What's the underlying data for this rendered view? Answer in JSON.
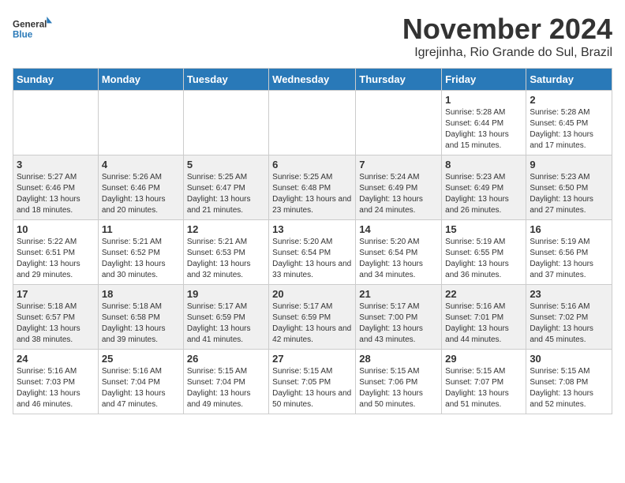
{
  "logo": {
    "line1": "General",
    "line2": "Blue"
  },
  "title": "November 2024",
  "subtitle": "Igrejinha, Rio Grande do Sul, Brazil",
  "days_of_week": [
    "Sunday",
    "Monday",
    "Tuesday",
    "Wednesday",
    "Thursday",
    "Friday",
    "Saturday"
  ],
  "weeks": [
    [
      {
        "day": "",
        "info": ""
      },
      {
        "day": "",
        "info": ""
      },
      {
        "day": "",
        "info": ""
      },
      {
        "day": "",
        "info": ""
      },
      {
        "day": "",
        "info": ""
      },
      {
        "day": "1",
        "info": "Sunrise: 5:28 AM\nSunset: 6:44 PM\nDaylight: 13 hours and 15 minutes."
      },
      {
        "day": "2",
        "info": "Sunrise: 5:28 AM\nSunset: 6:45 PM\nDaylight: 13 hours and 17 minutes."
      }
    ],
    [
      {
        "day": "3",
        "info": "Sunrise: 5:27 AM\nSunset: 6:46 PM\nDaylight: 13 hours and 18 minutes."
      },
      {
        "day": "4",
        "info": "Sunrise: 5:26 AM\nSunset: 6:46 PM\nDaylight: 13 hours and 20 minutes."
      },
      {
        "day": "5",
        "info": "Sunrise: 5:25 AM\nSunset: 6:47 PM\nDaylight: 13 hours and 21 minutes."
      },
      {
        "day": "6",
        "info": "Sunrise: 5:25 AM\nSunset: 6:48 PM\nDaylight: 13 hours and 23 minutes."
      },
      {
        "day": "7",
        "info": "Sunrise: 5:24 AM\nSunset: 6:49 PM\nDaylight: 13 hours and 24 minutes."
      },
      {
        "day": "8",
        "info": "Sunrise: 5:23 AM\nSunset: 6:49 PM\nDaylight: 13 hours and 26 minutes."
      },
      {
        "day": "9",
        "info": "Sunrise: 5:23 AM\nSunset: 6:50 PM\nDaylight: 13 hours and 27 minutes."
      }
    ],
    [
      {
        "day": "10",
        "info": "Sunrise: 5:22 AM\nSunset: 6:51 PM\nDaylight: 13 hours and 29 minutes."
      },
      {
        "day": "11",
        "info": "Sunrise: 5:21 AM\nSunset: 6:52 PM\nDaylight: 13 hours and 30 minutes."
      },
      {
        "day": "12",
        "info": "Sunrise: 5:21 AM\nSunset: 6:53 PM\nDaylight: 13 hours and 32 minutes."
      },
      {
        "day": "13",
        "info": "Sunrise: 5:20 AM\nSunset: 6:54 PM\nDaylight: 13 hours and 33 minutes."
      },
      {
        "day": "14",
        "info": "Sunrise: 5:20 AM\nSunset: 6:54 PM\nDaylight: 13 hours and 34 minutes."
      },
      {
        "day": "15",
        "info": "Sunrise: 5:19 AM\nSunset: 6:55 PM\nDaylight: 13 hours and 36 minutes."
      },
      {
        "day": "16",
        "info": "Sunrise: 5:19 AM\nSunset: 6:56 PM\nDaylight: 13 hours and 37 minutes."
      }
    ],
    [
      {
        "day": "17",
        "info": "Sunrise: 5:18 AM\nSunset: 6:57 PM\nDaylight: 13 hours and 38 minutes."
      },
      {
        "day": "18",
        "info": "Sunrise: 5:18 AM\nSunset: 6:58 PM\nDaylight: 13 hours and 39 minutes."
      },
      {
        "day": "19",
        "info": "Sunrise: 5:17 AM\nSunset: 6:59 PM\nDaylight: 13 hours and 41 minutes."
      },
      {
        "day": "20",
        "info": "Sunrise: 5:17 AM\nSunset: 6:59 PM\nDaylight: 13 hours and 42 minutes."
      },
      {
        "day": "21",
        "info": "Sunrise: 5:17 AM\nSunset: 7:00 PM\nDaylight: 13 hours and 43 minutes."
      },
      {
        "day": "22",
        "info": "Sunrise: 5:16 AM\nSunset: 7:01 PM\nDaylight: 13 hours and 44 minutes."
      },
      {
        "day": "23",
        "info": "Sunrise: 5:16 AM\nSunset: 7:02 PM\nDaylight: 13 hours and 45 minutes."
      }
    ],
    [
      {
        "day": "24",
        "info": "Sunrise: 5:16 AM\nSunset: 7:03 PM\nDaylight: 13 hours and 46 minutes."
      },
      {
        "day": "25",
        "info": "Sunrise: 5:16 AM\nSunset: 7:04 PM\nDaylight: 13 hours and 47 minutes."
      },
      {
        "day": "26",
        "info": "Sunrise: 5:15 AM\nSunset: 7:04 PM\nDaylight: 13 hours and 49 minutes."
      },
      {
        "day": "27",
        "info": "Sunrise: 5:15 AM\nSunset: 7:05 PM\nDaylight: 13 hours and 50 minutes."
      },
      {
        "day": "28",
        "info": "Sunrise: 5:15 AM\nSunset: 7:06 PM\nDaylight: 13 hours and 50 minutes."
      },
      {
        "day": "29",
        "info": "Sunrise: 5:15 AM\nSunset: 7:07 PM\nDaylight: 13 hours and 51 minutes."
      },
      {
        "day": "30",
        "info": "Sunrise: 5:15 AM\nSunset: 7:08 PM\nDaylight: 13 hours and 52 minutes."
      }
    ]
  ]
}
